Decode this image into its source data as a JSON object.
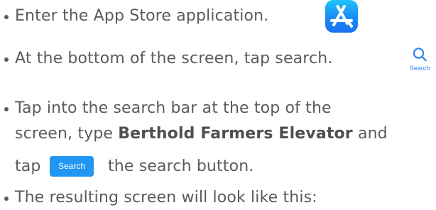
{
  "steps": {
    "step1": {
      "text": "Enter the App Store application."
    },
    "step2": {
      "text": "At the bottom of the screen, tap search.",
      "tab_label": "Search"
    },
    "step3": {
      "line1": "Tap into the search bar at the top of the",
      "line2_prefix": "screen, type ",
      "line2_bold": "Berthold Farmers Elevator",
      "line2_suffix": " and",
      "line3_prefix": "tap",
      "button_label": "Search",
      "line3_suffix": "the search button."
    },
    "step4": {
      "text": "The resulting screen will look like this:"
    }
  },
  "colors": {
    "text": "#5b5b5b",
    "accent": "#2196f3",
    "app_store_icon_top": "#1ec3fb",
    "app_store_icon_bottom": "#1c6ff2"
  },
  "icons": [
    "app-store-icon",
    "search-icon"
  ]
}
